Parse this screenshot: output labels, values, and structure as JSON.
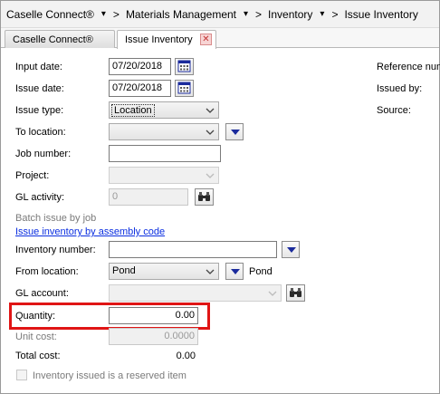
{
  "breadcrumb": {
    "items": [
      "Caselle Connect®",
      "Materials Management",
      "Inventory",
      "Issue Inventory"
    ],
    "separator": ">"
  },
  "tabs": [
    {
      "label": "Caselle Connect®",
      "active": false
    },
    {
      "label": "Issue Inventory",
      "active": true
    }
  ],
  "form": {
    "input_date": {
      "label": "Input date:",
      "value": "07/20/2018"
    },
    "issue_date": {
      "label": "Issue date:",
      "value": "07/20/2018"
    },
    "issue_type": {
      "label": "Issue type:",
      "value": "Location"
    },
    "to_location": {
      "label": "To location:",
      "value": ""
    },
    "job_number": {
      "label": "Job number:",
      "value": ""
    },
    "project": {
      "label": "Project:",
      "value": ""
    },
    "gl_activity": {
      "label": "GL activity:",
      "value": "0"
    },
    "batch_issue_text": "Batch issue by job",
    "assembly_link": "Issue inventory by assembly code",
    "inventory_number": {
      "label": "Inventory number:",
      "value": ""
    },
    "from_location": {
      "label": "From location:",
      "value": "Pond",
      "display": "Pond"
    },
    "gl_account": {
      "label": "GL account:",
      "value": ""
    },
    "quantity": {
      "label": "Quantity:",
      "value": "0.00"
    },
    "unit_cost": {
      "label": "Unit cost:",
      "value": "0.0000"
    },
    "total_cost": {
      "label": "Total cost:",
      "value": "0.00"
    },
    "reserved_checkbox": {
      "label": "Inventory issued is a reserved item",
      "checked": false
    }
  },
  "right_panel": {
    "reference_label": "Reference num",
    "issued_by_label": "Issued by:",
    "source_label": "Source:"
  },
  "colors": {
    "highlight": "#e01515",
    "link": "#0a2ee0",
    "dropdown_arrow": "#1b2b9c"
  },
  "icons": {
    "calendar": "calendar-icon",
    "lookup": "binoculars-icon",
    "dropdown": "dropdown-arrow-icon",
    "close": "close-icon"
  }
}
